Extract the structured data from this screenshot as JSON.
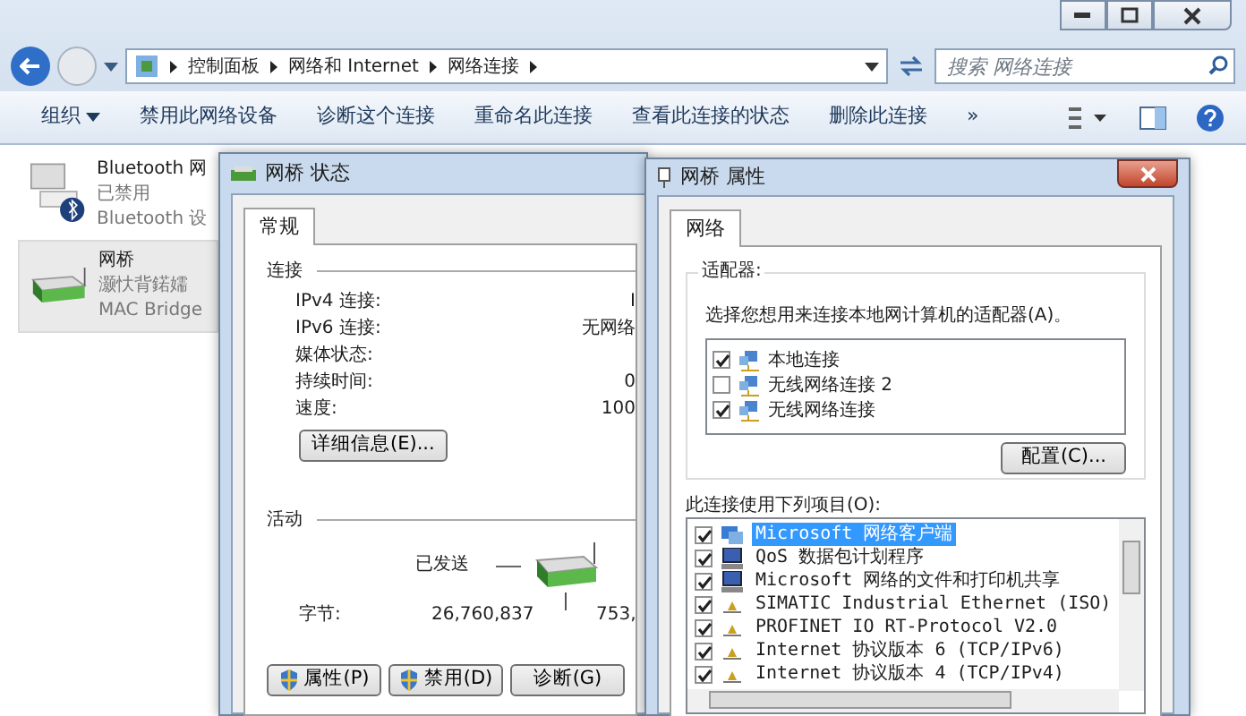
{
  "explorer": {
    "breadcrumb": [
      "控制面板",
      "网络和 Internet",
      "网络连接"
    ],
    "search": {
      "placeholder": "搜索 网络连接"
    },
    "toolbar": [
      {
        "label": "组织",
        "dropdown": true
      },
      {
        "label": "禁用此网络设备",
        "dropdown": false
      },
      {
        "label": "诊断这个连接",
        "dropdown": false
      },
      {
        "label": "重命名此连接",
        "dropdown": false
      },
      {
        "label": "查看此连接的状态",
        "dropdown": false
      },
      {
        "label": "删除此连接",
        "dropdown": false
      },
      {
        "label": "»",
        "dropdown": false
      }
    ],
    "connections": [
      {
        "kind": "bluetooth",
        "name": "Bluetooth 网",
        "status": "已禁用",
        "device": "Bluetooth 设",
        "selected": false
      },
      {
        "kind": "bridge",
        "name": "网桥",
        "status": "灏忕背鍩嬬",
        "device": "MAC Bridge",
        "selected": true
      }
    ]
  },
  "status_dialog": {
    "title": "网桥 状态",
    "tabs": [
      {
        "label": "常规",
        "selected": true
      }
    ],
    "connection": {
      "heading": "连接",
      "rows": [
        {
          "label": "IPv4 连接:",
          "value": "I"
        },
        {
          "label": "IPv6 连接:",
          "value": "无网络"
        },
        {
          "label": "媒体状态:",
          "value": ""
        },
        {
          "label": "持续时间:",
          "value": "0"
        },
        {
          "label": "速度:",
          "value": "100"
        }
      ]
    },
    "details_button": "详细信息(E)...",
    "activity": {
      "heading": "活动",
      "sent_label": "已发送",
      "bytes_label": "字节:",
      "sent": "26,760,837",
      "received": "753,"
    },
    "buttons": [
      {
        "label": "属性(P)",
        "shield": true
      },
      {
        "label": "禁用(D)",
        "shield": true
      },
      {
        "label": "诊断(G)",
        "shield": false
      }
    ]
  },
  "properties_dialog": {
    "title": "网桥 属性",
    "tabs": [
      {
        "label": "网络",
        "selected": true
      }
    ],
    "adapters_heading": "适配器:",
    "adapters_prompt": "选择您想用来连接本地网计算机的适配器(A)。",
    "adapters": [
      {
        "label": "本地连接",
        "checked": true
      },
      {
        "label": "无线网络连接 2",
        "checked": false
      },
      {
        "label": "无线网络连接",
        "checked": true
      }
    ],
    "configure_button": "配置(C)...",
    "items_heading": "此连接使用下列项目(O):",
    "items": [
      {
        "kind": "client",
        "label": "Microsoft 网络客户端",
        "checked": true,
        "selected": true
      },
      {
        "kind": "service",
        "label": "QoS 数据包计划程序",
        "checked": true,
        "selected": false
      },
      {
        "kind": "service",
        "label": "Microsoft 网络的文件和打印机共享",
        "checked": true,
        "selected": false
      },
      {
        "kind": "protocol",
        "label": "SIMATIC Industrial Ethernet (ISO)",
        "checked": true,
        "selected": false
      },
      {
        "kind": "protocol",
        "label": "PROFINET IO RT-Protocol V2.0",
        "checked": true,
        "selected": false
      },
      {
        "kind": "protocol",
        "label": "Internet 协议版本 6 (TCP/IPv6)",
        "checked": true,
        "selected": false
      },
      {
        "kind": "protocol",
        "label": "Internet 协议版本 4 (TCP/IPv4)",
        "checked": true,
        "selected": false
      }
    ]
  }
}
